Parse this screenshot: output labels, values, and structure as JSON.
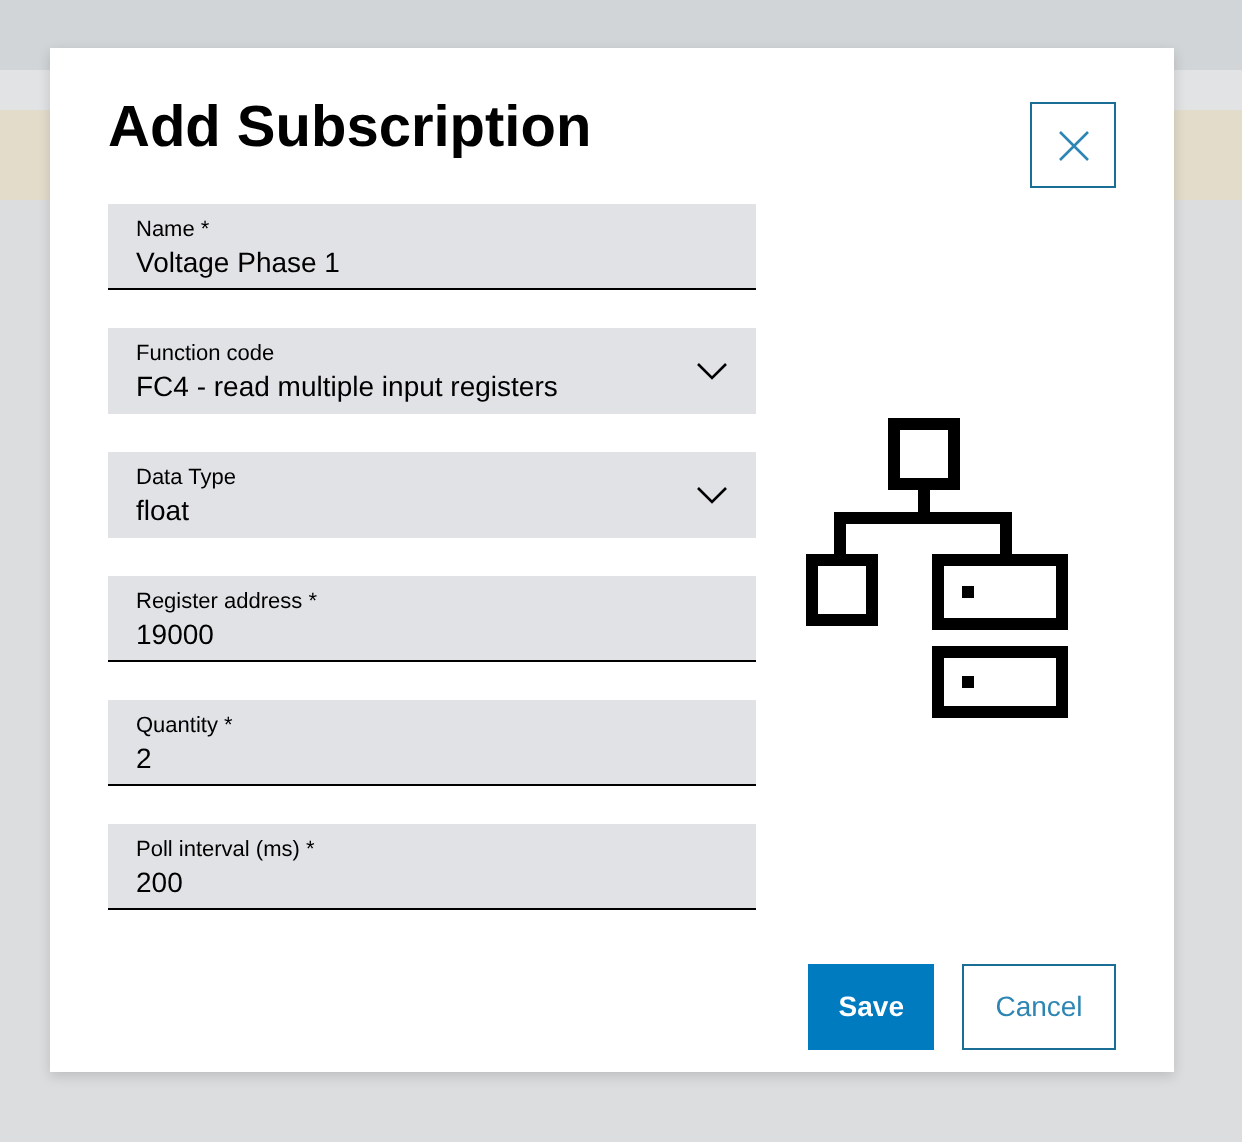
{
  "dialog": {
    "title": "Add Subscription",
    "fields": [
      {
        "kind": "text",
        "label": "Name *",
        "value": "Voltage Phase 1"
      },
      {
        "kind": "select",
        "label": "Function code",
        "value": "FC4 - read multiple input registers"
      },
      {
        "kind": "select",
        "label": "Data Type",
        "value": "float"
      },
      {
        "kind": "text",
        "label": "Register address *",
        "value": "19000"
      },
      {
        "kind": "text",
        "label": "Quantity *",
        "value": "2"
      },
      {
        "kind": "text",
        "label": "Poll interval (ms) *",
        "value": "200"
      }
    ],
    "buttons": [
      {
        "kind": "primary",
        "label": "Save"
      },
      {
        "kind": "secondary",
        "label": "Cancel"
      }
    ]
  }
}
